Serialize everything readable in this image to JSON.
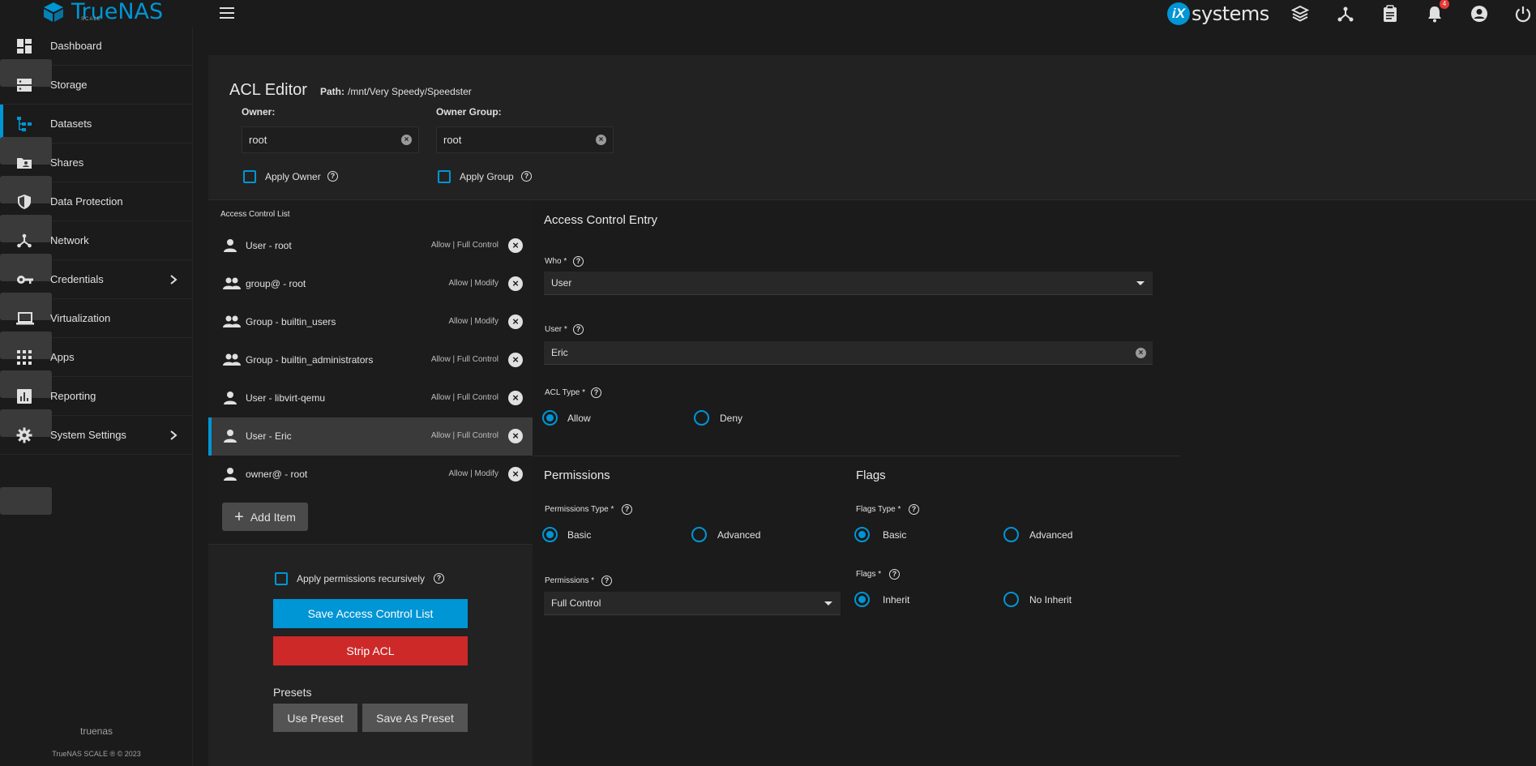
{
  "header": {
    "logo_text": "TrueNAS",
    "logo_sub": "SCALE",
    "brand_right_mark": "iX",
    "brand_right_text": "systems",
    "notification_count": "4",
    "icons": [
      "truecommand-icon",
      "network-share-icon",
      "clipboard-icon",
      "bell-icon",
      "account-icon",
      "power-icon"
    ]
  },
  "sidebar": {
    "items": [
      {
        "label": "Dashboard",
        "icon": "dashboard-icon"
      },
      {
        "label": "Storage",
        "icon": "storage-icon"
      },
      {
        "label": "Datasets",
        "icon": "datasets-icon"
      },
      {
        "label": "Shares",
        "icon": "shares-icon"
      },
      {
        "label": "Data Protection",
        "icon": "shield-icon"
      },
      {
        "label": "Network",
        "icon": "network-icon"
      },
      {
        "label": "Credentials",
        "icon": "key-icon"
      },
      {
        "label": "Virtualization",
        "icon": "laptop-icon"
      },
      {
        "label": "Apps",
        "icon": "apps-grid-icon"
      },
      {
        "label": "Reporting",
        "icon": "chart-icon"
      },
      {
        "label": "System Settings",
        "icon": "gear-icon"
      }
    ],
    "hostname": "truenas",
    "copyright": "TrueNAS SCALE ® © 2023",
    "accent": "#0095d5"
  },
  "editor": {
    "title": "ACL Editor",
    "path_label": "Path:",
    "path_value": "/mnt/Very Speedy/Speedster",
    "owner_label": "Owner:",
    "owner_value": "root",
    "owner_group_label": "Owner Group:",
    "owner_group_value": "root",
    "apply_owner_label": "Apply Owner",
    "apply_group_label": "Apply Group"
  },
  "acl": {
    "title": "Access Control List",
    "entries": [
      {
        "who": "User - root",
        "perm": "Allow | Full Control",
        "icon": "user-icon"
      },
      {
        "who": "group@ - root",
        "perm": "Allow | Modify",
        "icon": "group-icon"
      },
      {
        "who": "Group - builtin_users",
        "perm": "Allow | Modify",
        "icon": "group-icon"
      },
      {
        "who": "Group - builtin_administrators",
        "perm": "Allow | Full Control",
        "icon": "group-icon"
      },
      {
        "who": "User - libvirt-qemu",
        "perm": "Allow | Full Control",
        "icon": "user-icon"
      },
      {
        "who": "User - Eric",
        "perm": "Allow | Full Control",
        "icon": "user-icon"
      },
      {
        "who": "owner@ - root",
        "perm": "Allow | Modify",
        "icon": "user-icon"
      }
    ],
    "add_item_label": "Add Item",
    "apply_recursive_label": "Apply permissions recursively",
    "save_label": "Save Access Control List",
    "strip_label": "Strip ACL",
    "presets_label": "Presets",
    "use_preset_label": "Use Preset",
    "save_preset_label": "Save As Preset"
  },
  "ace": {
    "title": "Access Control Entry",
    "who_label": "Who *",
    "who_value": "User",
    "user_label": "User *",
    "user_value": "Eric",
    "acl_type_label": "ACL Type *",
    "acl_type_options": [
      "Allow",
      "Deny"
    ],
    "acl_type_selected": "Allow",
    "permissions_title": "Permissions",
    "permissions_type_label": "Permissions Type *",
    "permissions_type_options": [
      "Basic",
      "Advanced"
    ],
    "permissions_label": "Permissions *",
    "permissions_value": "Full Control",
    "flags_title": "Flags",
    "flags_type_label": "Flags Type *",
    "flags_type_options": [
      "Basic",
      "Advanced"
    ],
    "flags_label": "Flags *",
    "flags_options": [
      "Inherit",
      "No Inherit"
    ]
  }
}
